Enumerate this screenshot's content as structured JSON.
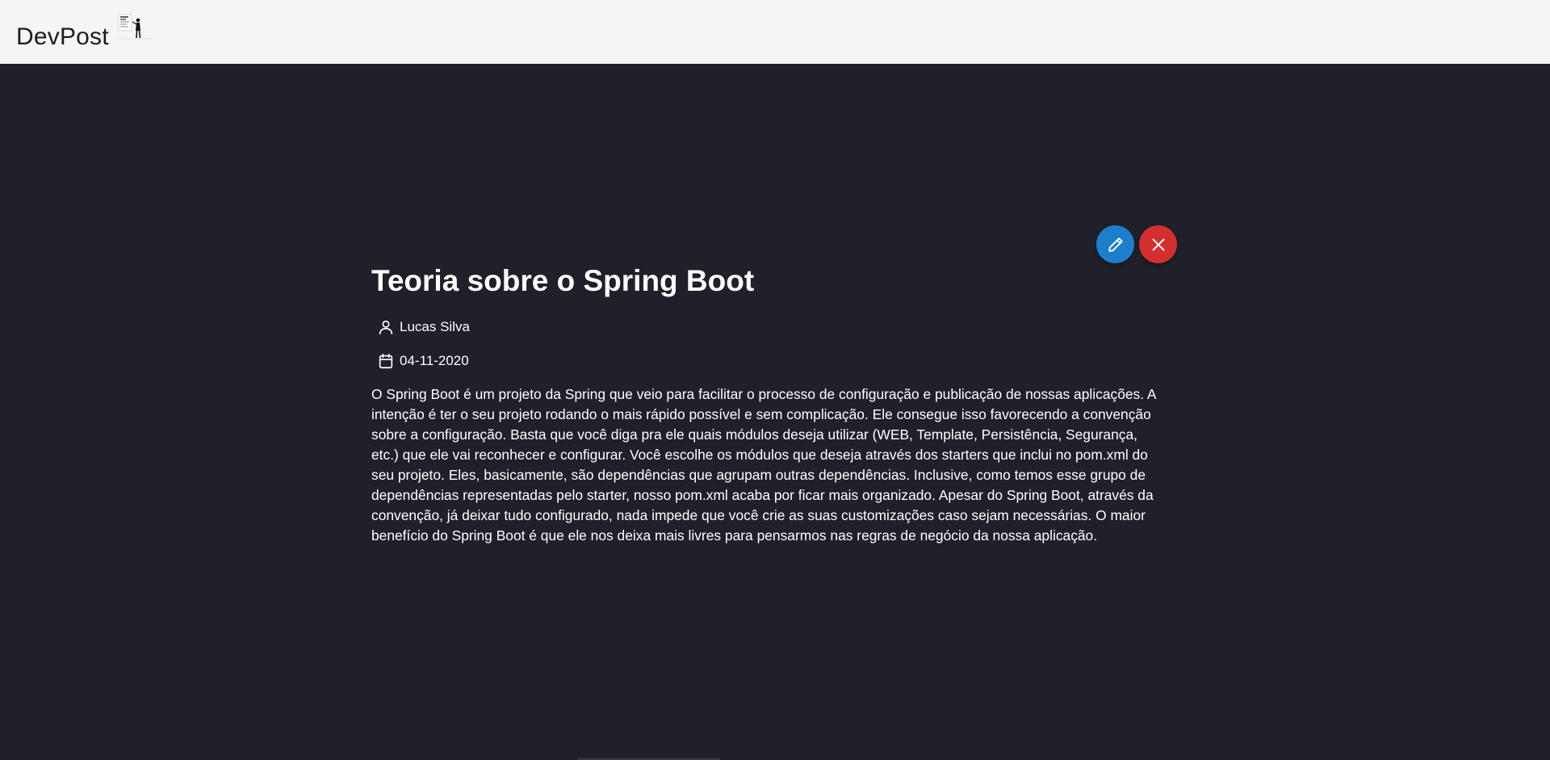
{
  "header": {
    "brand": "DevPost",
    "logo_icon": "developer-at-whiteboard-icon"
  },
  "actions": {
    "edit_icon": "pencil-icon",
    "delete_icon": "close-icon",
    "edit_color": "#1b7fcc",
    "delete_color": "#d32f2f"
  },
  "post": {
    "title": "Teoria sobre o Spring Boot",
    "author": "Lucas Silva",
    "date": "04-11-2020",
    "body": "O Spring Boot é um projeto da Spring que veio para facilitar o processo de configuração e publicação de nossas aplicações. A intenção é ter o seu projeto rodando o mais rápido possível e sem complicação. Ele consegue isso favorecendo a convenção sobre a configuração. Basta que você diga pra ele quais módulos deseja utilizar (WEB, Template, Persistência, Segurança, etc.) que ele vai reconhecer e configurar. Você escolhe os módulos que deseja através dos starters que inclui no pom.xml do seu projeto. Eles, basicamente, são dependências que agrupam outras dependências. Inclusive, como temos esse grupo de dependências representadas pelo starter, nosso pom.xml acaba por ficar mais organizado. Apesar do Spring Boot, através da convenção, já deixar tudo configurado, nada impede que você crie as suas customizações caso sejam necessárias. O maior benefício do Spring Boot é que ele nos deixa mais livres para pensarmos nas regras de negócio da nossa aplicação."
  },
  "colors": {
    "background": "#1f2029",
    "topbar": "#f5f5f5"
  }
}
